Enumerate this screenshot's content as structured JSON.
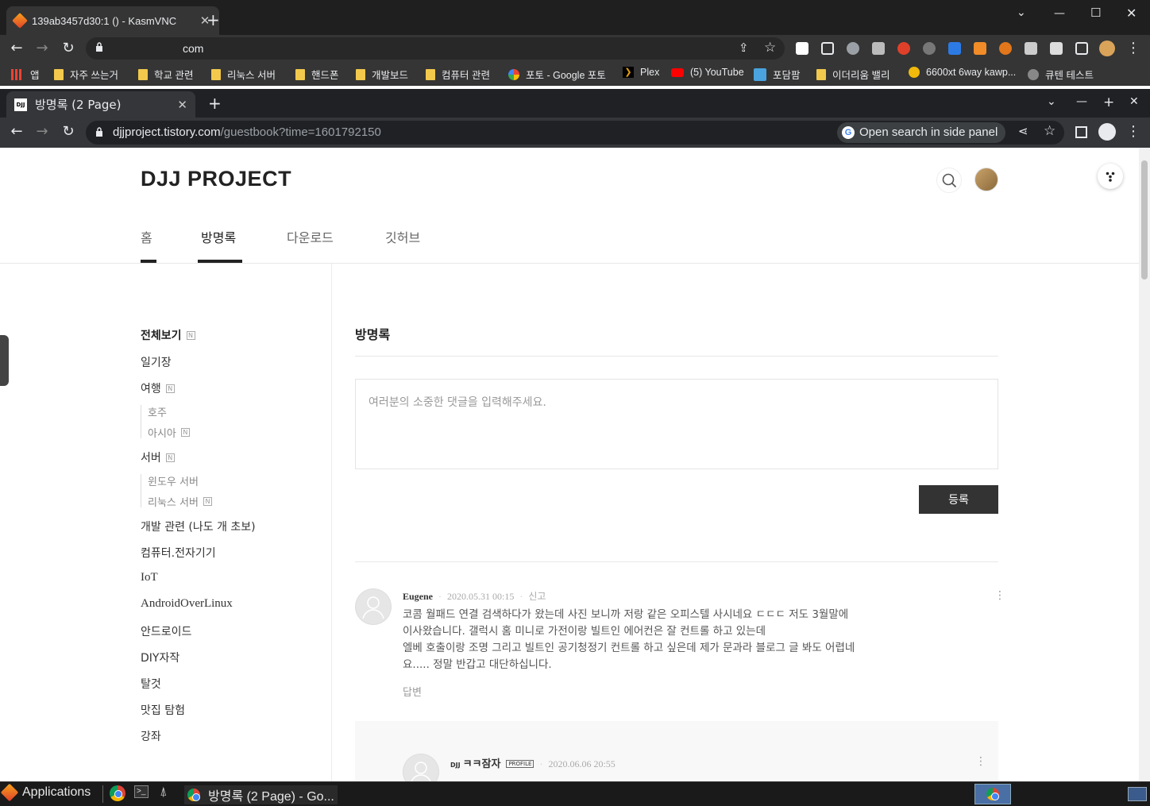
{
  "outer_browser": {
    "tab_title": "139ab3457d30:1 () - KasmVNC",
    "url": "com",
    "bookmarks": [
      "앱",
      "자주 쓰는거",
      "학교 관련",
      "리눅스 서버",
      "핸드폰",
      "개발보드",
      "컴퓨터 관련",
      "포토 - Google 포토",
      "Plex",
      "(5) YouTube",
      "포담팜",
      "이더리움 밸리",
      "6600xt 6way kawp...",
      "큐텐 테스트"
    ]
  },
  "inner_browser": {
    "tab_title": "방명록 (2 Page)",
    "url_host": "djjproject.tistory.com",
    "url_path": "/guestbook?time=1601792150",
    "side_panel_label": "Open search in side panel"
  },
  "page": {
    "blog_title": "DJJ PROJECT",
    "nav": [
      "홈",
      "방명록",
      "다운로드",
      "깃허브"
    ],
    "active_nav": "방명록",
    "categories": {
      "all": "전체보기",
      "diary": "일기장",
      "travel": "여행",
      "travel_au": "호주",
      "travel_asia": "아시아",
      "server": "서버",
      "server_win": "윈도우 서버",
      "server_linux": "리눅스 서버",
      "dev": "개발 관련 (나도 개 초보)",
      "computer": "컴퓨터.전자기기",
      "iot": "IoT",
      "aol": "AndroidOverLinux",
      "android": "안드로이드",
      "diy": "DIY자작",
      "jailbreak": "탈것",
      "food": "맛집 탐험",
      "lecture": "강좌"
    },
    "new_badge": "N",
    "guestbook": {
      "heading": "방명록",
      "placeholder": "여러분의 소중한 댓글을 입력해주세요.",
      "submit_label": "등록",
      "comments": [
        {
          "author": "Eugene",
          "date": "2020.05.31 00:15",
          "report": "신고",
          "body": "코콤 월패드 연결 검색하다가 왔는데 사진 보니까 저랑 같은 오피스텔 사시네요 ㄷㄷㄷ 저도 3월말에\n이사왔습니다. 갤럭시 홈 미니로 가전이랑 빌트인 에어컨은 잘 컨트롤 하고 있는데\n엘베 호출이랑 조명 그리고 빌트인 공기청정기 컨트롤 하고 싶은데 제가 문과라 블로그 글 봐도 어렵네\n요..... 정말 반갑고 대단하십니다.",
          "reply_label": "답변"
        }
      ],
      "reply": {
        "author_prefix": "DJJ",
        "author": "ㅋㅋ잠자",
        "profile_badge": "PROFILE",
        "date": "2020.06.06 20:55"
      }
    }
  },
  "taskbar": {
    "applications_label": "Applications",
    "window_label": "방명록 (2 Page) - Go..."
  }
}
